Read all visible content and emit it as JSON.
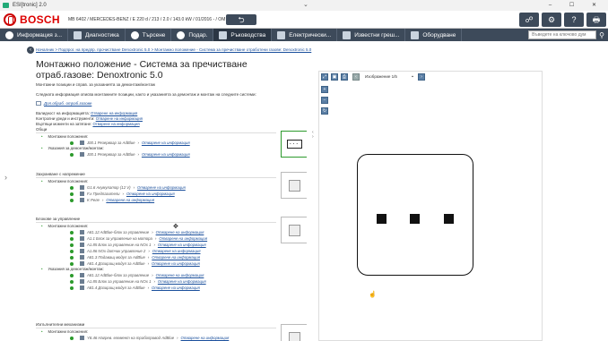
{
  "window": {
    "title": "ESI[tronic] 2.0",
    "controls": "– ☐ ✕"
  },
  "brand": {
    "name": "BOSCH",
    "accent": "#d00000"
  },
  "vehicle": {
    "info": "MB 6402 / MERCEDES-BENZ / E 220 d / 213 / 2.0 / 143.0 kW / 01/2016 - / OM 654.920"
  },
  "toolbar": {
    "back": "⮌",
    "tools": [
      "☍",
      "⚙",
      "?",
      "🖶"
    ]
  },
  "nav": {
    "items": [
      {
        "label": "Информация з...",
        "icon": "info-icon"
      },
      {
        "label": "Диагностика",
        "icon": "diagnostics-icon"
      },
      {
        "label": "Търсене",
        "icon": "search-icon"
      },
      {
        "label": "Подар.",
        "icon": "gear-icon"
      },
      {
        "label": "Ръководства",
        "icon": "wrench-icon"
      },
      {
        "label": "Електрически...",
        "icon": "lightning-icon"
      },
      {
        "label": "Известни греш...",
        "icon": "book-icon"
      },
      {
        "label": "Оборудване",
        "icon": "external-icon"
      }
    ],
    "search_placeholder": "Въведете на ключово дум"
  },
  "breadcrumb": {
    "text": "Началник > Подпрог. на предпр. прочистване Denoxtronic 5.0 > Монтажно положение - Система за пречистване отработени газове: Denoxtronic 5.0"
  },
  "doc": {
    "title": "Монтажно положение - Система за пречистване отраб.газове: Denoxtronic 5.0",
    "subtitle": "Монтажни позиции и справ. за указанията за демонтаж/монтаж",
    "description": "Следната информация описва монтажните позиции, както и указанията за демонтаж и монтаж на следните системи:",
    "attachment": "Доп.обраб. отраб.газове",
    "meta": [
      {
        "label": "Валидност на информацията:",
        "link": "Отварене на информация"
      },
      {
        "label": "Контролни уреди и инструменти:",
        "link": "Отварене на информация"
      },
      {
        "label": "Въртящи моменти на затягане:",
        "link": "Отварене на информация"
      }
    ],
    "sections": [
      {
        "title": "Общи",
        "groups": [
          {
            "label": "Монтажни положения:",
            "items": [
              {
                "name": "J00.1 Резервоар за AdBlue",
                "link": "Отварене на информация"
              }
            ]
          },
          {
            "label": "Указания за демонтаж/монтаж:",
            "items": [
              {
                "name": "J00.1 Резервоар за AdBlue",
                "link": "Отварене на информация"
              }
            ]
          }
        ]
      },
      {
        "title": "Захранване с напрежение",
        "groups": [
          {
            "label": "Монтажни положения:",
            "items": [
              {
                "name": "G1.6 Акумулатор (12 V)",
                "link": "Отварене на информация"
              },
              {
                "name": "F.x Предпазители",
                "link": "Отварене на информация"
              },
              {
                "name": "K Реле",
                "link": "Отварене на информация"
              }
            ]
          }
        ]
      },
      {
        "title": "Блокове за управление",
        "groups": [
          {
            "label": "Монтажни положения:",
            "items": [
              {
                "name": "A81.12 AdBlue-блок за управление",
                "link": "Отварене на информация"
              },
              {
                "name": "A1.1 Блок за управление на мотора",
                "link": "Отварене на информация"
              },
              {
                "name": "A1.85 Блок за управление на NOx 1",
                "link": "Отварене на информация"
              },
              {
                "name": "A1.86 NOx датчик управление 2",
                "link": "Отварене на информация"
              },
              {
                "name": "A81.3 Подаващ модул за AdBlue",
                "link": "Отварене на информация"
              },
              {
                "name": "A81.4 Дозиращ модул за AdBlue",
                "link": "Отварене на информация"
              }
            ]
          },
          {
            "label": "Указания за демонтаж/монтаж:",
            "items": [
              {
                "name": "A81.12 AdBlue-блок за управление",
                "link": "Отварене на информация"
              },
              {
                "name": "A1.85 Блок за управление на NOx 1",
                "link": "Отварене на информация"
              },
              {
                "name": "A81.4 Дозиращ модул за AdBlue",
                "link": "Отварене на информация"
              }
            ]
          }
        ]
      },
      {
        "title": "Изпълнителни механизми",
        "groups": [
          {
            "label": "Монтажни положения:",
            "items": [
              {
                "name": "Y8.46 Нагрев. елемент на трабопровод AdBlue",
                "link": "Отварене на информация"
              }
            ]
          }
        ]
      }
    ]
  },
  "viewer": {
    "label": "Изображение 1/5"
  }
}
